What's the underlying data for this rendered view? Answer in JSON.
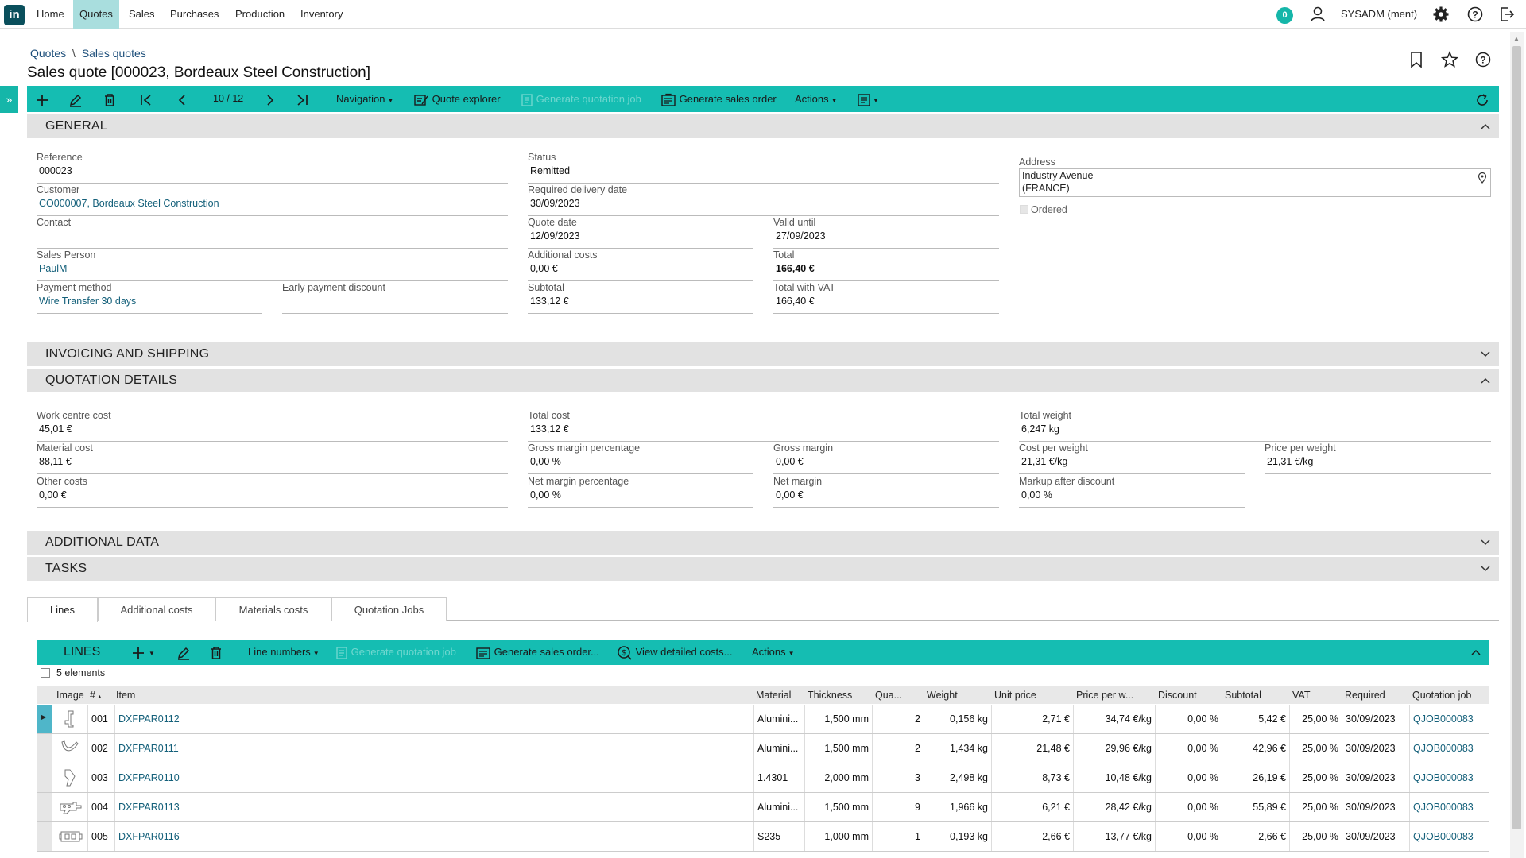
{
  "nav": {
    "logo": "in",
    "items": [
      "Home",
      "Quotes",
      "Sales",
      "Purchases",
      "Production",
      "Inventory"
    ],
    "notification_count": "0",
    "user": "SYSADM (ment)"
  },
  "breadcrumb": [
    "Quotes",
    "\\",
    "Sales quotes"
  ],
  "title": "Sales quote [000023, Bordeaux Steel Construction]",
  "toolbar": {
    "record_position": "10 / 12",
    "navigation": "Navigation",
    "quote_explorer": "Quote explorer",
    "generate_job": "Generate quotation job",
    "generate_order": "Generate sales order",
    "actions": "Actions"
  },
  "sections": {
    "general": "GENERAL",
    "invoicing": "INVOICING AND SHIPPING",
    "quotation": "QUOTATION DETAILS",
    "additional": "ADDITIONAL DATA",
    "tasks": "TASKS"
  },
  "general": {
    "reference": {
      "label": "Reference",
      "value": "000023"
    },
    "customer": {
      "label": "Customer",
      "value": "CO000007, Bordeaux Steel Construction"
    },
    "contact": {
      "label": "Contact",
      "value": ""
    },
    "sales_person": {
      "label": "Sales Person",
      "value": "PaulM"
    },
    "payment_method": {
      "label": "Payment method",
      "value": "Wire Transfer 30 days"
    },
    "early_discount": {
      "label": "Early payment discount",
      "value": ""
    },
    "status": {
      "label": "Status",
      "value": "Remitted"
    },
    "required_delivery": {
      "label": "Required delivery date",
      "value": "30/09/2023"
    },
    "quote_date": {
      "label": "Quote date",
      "value": "12/09/2023"
    },
    "valid_until": {
      "label": "Valid until",
      "value": "27/09/2023"
    },
    "additional_costs": {
      "label": "Additional costs",
      "value": "0,00 €"
    },
    "total": {
      "label": "Total",
      "value": "166,40 €"
    },
    "subtotal": {
      "label": "Subtotal",
      "value": "133,12 €"
    },
    "total_vat": {
      "label": "Total with VAT",
      "value": "166,40 €"
    },
    "address": {
      "label": "Address",
      "line1": "Industry Avenue",
      "line2": "(FRANCE)"
    },
    "ordered": "Ordered"
  },
  "quotation": {
    "work_centre_cost": {
      "label": "Work centre cost",
      "value": "45,01 €"
    },
    "material_cost": {
      "label": "Material cost",
      "value": "88,11 €"
    },
    "other_costs": {
      "label": "Other costs",
      "value": "0,00 €"
    },
    "total_cost": {
      "label": "Total cost",
      "value": "133,12 €"
    },
    "gross_margin_pct": {
      "label": "Gross margin percentage",
      "value": "0,00 %"
    },
    "gross_margin": {
      "label": "Gross margin",
      "value": "0,00 €"
    },
    "net_margin_pct": {
      "label": "Net margin percentage",
      "value": "0,00 %"
    },
    "net_margin": {
      "label": "Net margin",
      "value": "0,00 €"
    },
    "total_weight": {
      "label": "Total weight",
      "value": "6,247 kg"
    },
    "cost_per_weight": {
      "label": "Cost per weight",
      "value": "21,31 €/kg"
    },
    "price_per_weight": {
      "label": "Price per weight",
      "value": "21,31 €/kg"
    },
    "markup": {
      "label": "Markup after discount",
      "value": "0,00 %"
    }
  },
  "tabs": [
    "Lines",
    "Additional costs",
    "Materials costs",
    "Quotation Jobs"
  ],
  "lines_toolbar": {
    "title": "LINES",
    "line_numbers": "Line numbers",
    "generate_job": "Generate quotation job",
    "generate_order": "Generate sales order...",
    "view_costs": "View detailed costs...",
    "actions": "Actions"
  },
  "element_count": "5 elements",
  "table": {
    "headers": [
      "Image",
      "#",
      "Item",
      "Material",
      "Thickness",
      "Qua...",
      "Weight",
      "Unit price",
      "Price per w...",
      "Discount",
      "Subtotal",
      "VAT",
      "Required",
      "Quotation job"
    ],
    "rows": [
      [
        "001",
        "DXFPAR0112",
        "Alumini...",
        "1,500 mm",
        "2",
        "0,156 kg",
        "2,71 €",
        "34,74 €/kg",
        "0,00 %",
        "5,42 €",
        "25,00 %",
        "30/09/2023",
        "QJOB000083"
      ],
      [
        "002",
        "DXFPAR0111",
        "Alumini...",
        "1,500 mm",
        "2",
        "1,434 kg",
        "21,48 €",
        "29,96 €/kg",
        "0,00 %",
        "42,96 €",
        "25,00 %",
        "30/09/2023",
        "QJOB000083"
      ],
      [
        "003",
        "DXFPAR0110",
        "1.4301",
        "2,000 mm",
        "3",
        "2,498 kg",
        "8,73 €",
        "10,48 €/kg",
        "0,00 %",
        "26,19 €",
        "25,00 %",
        "30/09/2023",
        "QJOB000083"
      ],
      [
        "004",
        "DXFPAR0113",
        "Alumini...",
        "1,500 mm",
        "9",
        "1,966 kg",
        "6,21 €",
        "28,42 €/kg",
        "0,00 %",
        "55,89 €",
        "25,00 %",
        "30/09/2023",
        "QJOB000083"
      ],
      [
        "005",
        "DXFPAR0116",
        "S235",
        "1,000 mm",
        "1",
        "0,193 kg",
        "2,66 €",
        "13,77 €/kg",
        "0,00 %",
        "2,66 €",
        "25,00 %",
        "30/09/2023",
        "QJOB000083"
      ]
    ]
  }
}
